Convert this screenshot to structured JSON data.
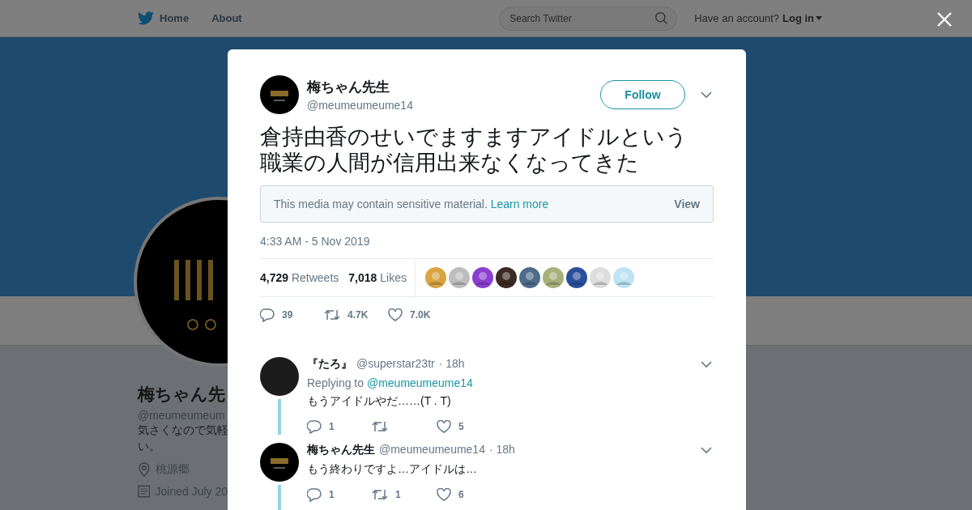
{
  "top_bar": {
    "nav": [
      {
        "kind": "home",
        "label": "Home"
      },
      {
        "kind": "plain",
        "label": "About"
      }
    ],
    "search": {
      "placeholder": "Search Twitter"
    },
    "account_prompt": "Have an account?",
    "login": "Log in"
  },
  "profile": {
    "name": "梅ちゃん先",
    "handle": "@meumeumeum",
    "bio": [
      "気さくなので気軽",
      "い。"
    ],
    "location": "桃源郷",
    "joined": "Joined July 20"
  },
  "tweet": {
    "name": "梅ちゃん先生",
    "handle": "@meumeumeume14",
    "follow": "Follow",
    "text_lines": [
      "倉持由香のせいでますますアイドルという",
      "職業の人間が信用出来なくなってきた"
    ],
    "sensitive": {
      "message": "This media may contain sensitive material.",
      "link": "Learn more",
      "view": "View"
    },
    "timestamp": "4:33 AM - 5 Nov 2019",
    "stats": [
      {
        "count": "4,729",
        "label": "Retweets"
      },
      {
        "count": "7,018",
        "label": "Likes"
      }
    ],
    "likers": [
      {
        "color": "#d9a441"
      },
      {
        "color": "#bdbdbd"
      },
      {
        "color": "#8a3fd1"
      },
      {
        "color": "#3a2a22"
      },
      {
        "color": "#4f6d8a"
      },
      {
        "color": "#a7b07a"
      },
      {
        "color": "#2b4e9a"
      },
      {
        "color": "#dddddd"
      },
      {
        "color": "#bfe3f2"
      }
    ],
    "actions": [
      {
        "kind": "reply",
        "count": "39"
      },
      {
        "kind": "retweet",
        "count": "4.7K"
      },
      {
        "kind": "like",
        "count": "7.0K"
      }
    ]
  },
  "replies": [
    {
      "kind": "plain",
      "name": "『たろ』",
      "handle": "@superstar23tr",
      "time": "· 18h",
      "replying_to": {
        "prefix": "Replying to",
        "handle": "@meumeumeume14"
      },
      "text": "もうアイドルやだ……(T . T)",
      "actions": [
        {
          "kind": "reply",
          "count": "1"
        },
        {
          "kind": "retweet"
        },
        {
          "kind": "like",
          "count": "5"
        }
      ]
    },
    {
      "kind": "logo",
      "name": "梅ちゃん先生",
      "handle": "@meumeumeume14",
      "time": "· 18h",
      "text": "もう終わりですよ…アイドルは…",
      "actions": [
        {
          "kind": "reply",
          "count": "1"
        },
        {
          "kind": "retweet",
          "count": "1"
        },
        {
          "kind": "like",
          "count": "6"
        }
      ]
    }
  ]
}
